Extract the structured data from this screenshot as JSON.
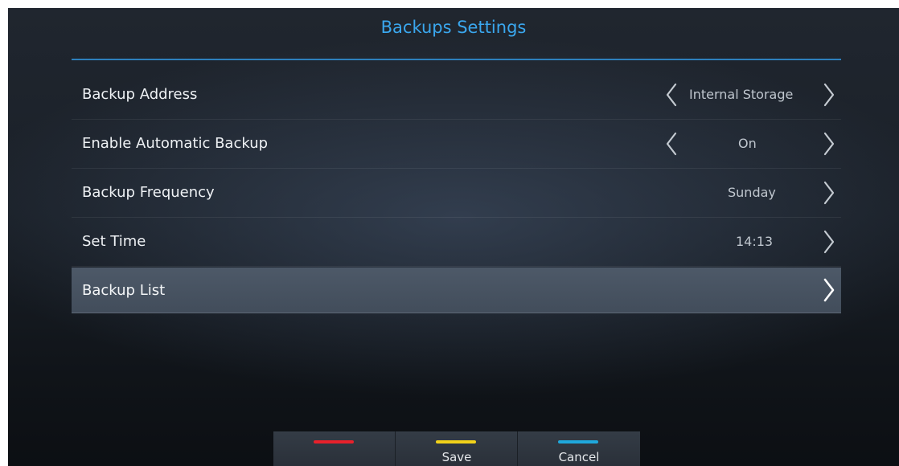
{
  "title": "Backups Settings",
  "settings": [
    {
      "label": "Backup Address",
      "value": "Internal Storage"
    },
    {
      "label": "Enable Automatic Backup",
      "value": "On"
    },
    {
      "label": "Backup Frequency",
      "value": "Sunday"
    },
    {
      "label": "Set Time",
      "value": "14:13"
    },
    {
      "label": "Backup List",
      "value": ""
    }
  ],
  "footer": {
    "keys": [
      {
        "color": "#e8212b",
        "label": ""
      },
      {
        "color": "#f2d21a",
        "label": "Save"
      },
      {
        "color": "#1fa8dc",
        "label": "Cancel"
      }
    ]
  },
  "colors": {
    "accent": "#3aa7ee",
    "selected_row": "#4a5564"
  }
}
